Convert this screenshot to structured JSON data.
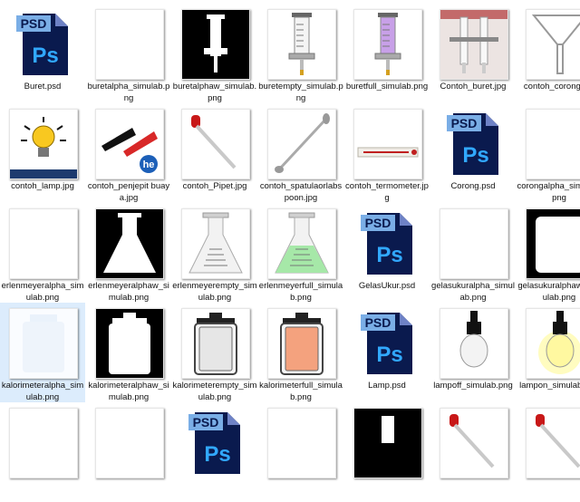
{
  "files": [
    {
      "name": "Buret.psd",
      "icon": "psd-icon"
    },
    {
      "name": "buretalpha_simulab.png",
      "icon": "blank-thumbnail"
    },
    {
      "name": "buretalphaw_simulab.png",
      "icon": "buret-silhouette-thumbnail"
    },
    {
      "name": "buretempty_simulab.png",
      "icon": "buret-empty-thumbnail"
    },
    {
      "name": "buretfull_simulab.png",
      "icon": "buret-full-thumbnail"
    },
    {
      "name": "Contoh_buret.jpg",
      "icon": "buret-photo-thumbnail"
    },
    {
      "name": "contoh_corong.jpg",
      "icon": "funnel-thumbnail"
    },
    {
      "name": "contoh_lamp.jpg",
      "icon": "lamp-photo-thumbnail"
    },
    {
      "name": "contoh_penjepit buaya.jpg",
      "icon": "alligator-clip-thumbnail"
    },
    {
      "name": "contoh_Pipet.jpg",
      "icon": "pipette-thumbnail"
    },
    {
      "name": "contoh_spatulaorlabspoon.jpg",
      "icon": "spatula-thumbnail"
    },
    {
      "name": "contoh_termometer.jpg",
      "icon": "thermometer-thumbnail"
    },
    {
      "name": "Corong.psd",
      "icon": "psd-icon"
    },
    {
      "name": "corongalpha_simulab.png",
      "icon": "blank-thumbnail"
    },
    {
      "name": "erlenmeyeralpha_simulab.png",
      "icon": "blank-thumbnail"
    },
    {
      "name": "erlenmeyeralphaw_simulab.png",
      "icon": "flask-silhouette-thumbnail"
    },
    {
      "name": "erlenmeyerempty_simulab.png",
      "icon": "flask-empty-thumbnail"
    },
    {
      "name": "erlenmeyerfull_simulab.png",
      "icon": "flask-full-thumbnail"
    },
    {
      "name": "GelasUkur.psd",
      "icon": "psd-icon"
    },
    {
      "name": "gelasukuralpha_simulab.png",
      "icon": "blank-thumbnail"
    },
    {
      "name": "gelasukuralphaw_simulab.png",
      "icon": "beaker-silhouette-thumbnail"
    },
    {
      "name": "kalorimeteralpha_simulab.png",
      "icon": "calorimeter-faint-thumbnail"
    },
    {
      "name": "kalorimeteralphaw_simulab.png",
      "icon": "calorimeter-silhouette-thumbnail"
    },
    {
      "name": "kalorimeterempty_simulab.png",
      "icon": "calorimeter-empty-thumbnail"
    },
    {
      "name": "kalorimeterfull_simulab.png",
      "icon": "calorimeter-full-thumbnail"
    },
    {
      "name": "Lamp.psd",
      "icon": "psd-icon"
    },
    {
      "name": "lampoff_simulab.png",
      "icon": "bulb-off-thumbnail"
    },
    {
      "name": "lampon_simulab.png",
      "icon": "bulb-on-thumbnail"
    },
    {
      "name": "",
      "icon": "blank-thumbnail"
    },
    {
      "name": "",
      "icon": "blank-thumbnail"
    },
    {
      "name": "",
      "icon": "psd-icon"
    },
    {
      "name": "",
      "icon": "blank-thumbnail"
    },
    {
      "name": "",
      "icon": "black-thumbnail"
    },
    {
      "name": "",
      "icon": "pipette-thumbnail"
    },
    {
      "name": "",
      "icon": "pipette-thumbnail"
    }
  ],
  "psd_badge": "PSD",
  "ps_letters": "Ps",
  "colors": {
    "selection": "#dcecfc",
    "psd_dark": "#0a1a4e",
    "psd_blue": "#31a8ff",
    "liquid_purple": "#c8a0e8",
    "liquid_green": "#a6e8a8",
    "liquid_orange": "#f4a27e"
  }
}
